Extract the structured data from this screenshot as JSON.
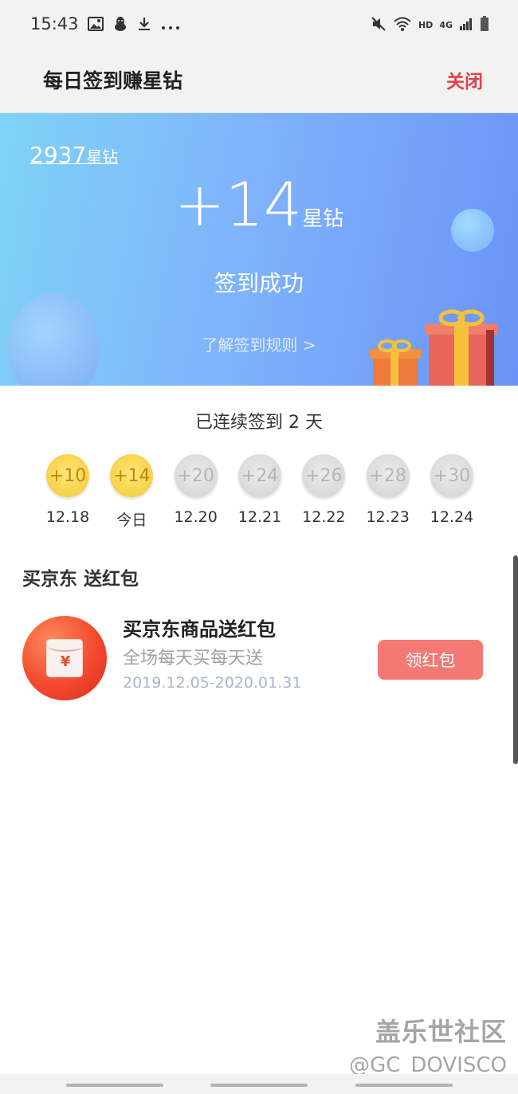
{
  "status_bar": {
    "time": "15:43",
    "left_icons": [
      "image-icon",
      "penguin-icon",
      "download-icon",
      "more-dots-icon"
    ],
    "right_icons": [
      "mute-icon",
      "wifi-icon",
      "hd-icon",
      "4g-icon",
      "signal-icon",
      "battery-icon"
    ],
    "hd_label": "HD",
    "network_label": "4G"
  },
  "header": {
    "title": "每日签到赚星钻",
    "close_label": "关闭"
  },
  "hero": {
    "balance_number": "2937",
    "balance_unit": "星钻",
    "gain_number": "+14",
    "gain_unit": "星钻",
    "success_text": "签到成功",
    "rules_link": "了解签到规则 >"
  },
  "streak_text": "已连续签到 2 天",
  "days": [
    {
      "reward": "+10",
      "label": "12.18",
      "state": "done"
    },
    {
      "reward": "+14",
      "label": "今日",
      "state": "done"
    },
    {
      "reward": "+20",
      "label": "12.20",
      "state": "pending"
    },
    {
      "reward": "+24",
      "label": "12.21",
      "state": "pending"
    },
    {
      "reward": "+26",
      "label": "12.22",
      "state": "pending"
    },
    {
      "reward": "+28",
      "label": "12.23",
      "state": "pending"
    },
    {
      "reward": "+30",
      "label": "12.24",
      "state": "pending"
    }
  ],
  "section": {
    "title": "买京东 送红包"
  },
  "promo": {
    "icon": "red-envelope-icon",
    "icon_symbol": "¥",
    "title": "买京东商品送红包",
    "subtitle": "全场每天买每天送",
    "date_range": "2019.12.05-2020.01.31",
    "button_label": "领红包"
  },
  "watermark": {
    "line1": "盖乐世社区",
    "line2": "@GC_DOVISCO"
  },
  "colors": {
    "accent_red": "#e2404b",
    "button_red": "#f47874",
    "coin_gold": "#f6d24b",
    "coin_grey": "#dadada",
    "hero_gradient_start": "#7fd3f7",
    "hero_gradient_end": "#6b93f7"
  }
}
